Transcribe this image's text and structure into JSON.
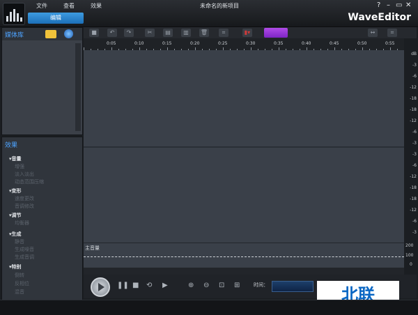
{
  "menu": {
    "file": "文件",
    "view": "查看",
    "effects": "效果"
  },
  "tab": {
    "edit": "编辑"
  },
  "window": {
    "title": "未命名的新项目",
    "help": "?",
    "minimize": "–",
    "maximize": "▭",
    "close": "✕"
  },
  "brand": "WaveEditor",
  "media": {
    "title": "媒体库"
  },
  "effects": {
    "title": "效果",
    "groups": [
      {
        "name": "音量",
        "items": [
          "增强",
          "淡入淡出",
          "动态范围压缩"
        ]
      },
      {
        "name": "变形",
        "items": [
          "速度更改",
          "音调修改"
        ]
      },
      {
        "name": "调节",
        "items": [
          "均衡器"
        ]
      },
      {
        "name": "生成",
        "items": [
          "静音",
          "生成噪音",
          "生成音调"
        ]
      },
      {
        "name": "特别",
        "items": [
          "倒转",
          "反相位",
          "混音"
        ]
      }
    ]
  },
  "ruler": {
    "ticks": [
      "0:05",
      "0:10",
      "0:15",
      "0:20",
      "0:25",
      "0:30",
      "0:35",
      "0:40",
      "0:45",
      "0:50",
      "0:55"
    ]
  },
  "db_scale": [
    "dB",
    "-3",
    "-6",
    "-12",
    "-18",
    "-18",
    "-12",
    "-6",
    "-3",
    "-3",
    "-6",
    "-12",
    "-18",
    "-18",
    "-12",
    "-6",
    "-3"
  ],
  "volume": {
    "label": "主音量",
    "scale": [
      "200",
      "100",
      "0"
    ]
  },
  "transport": {
    "time_label": "时间："
  },
  "watermark": "北联"
}
